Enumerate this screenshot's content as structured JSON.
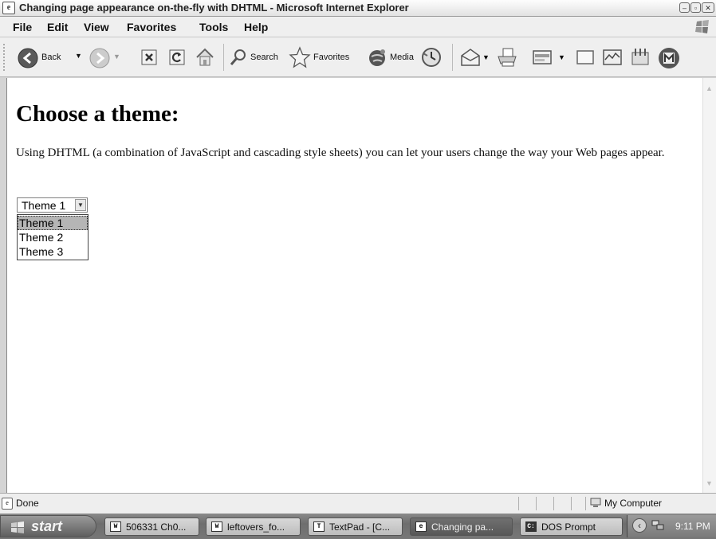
{
  "window": {
    "title": "Changing page appearance on-the-fly with DHTML - Microsoft Internet Explorer",
    "title_icon": "ie-page-icon",
    "controls": [
      "minimize",
      "maximize",
      "close"
    ]
  },
  "menu": {
    "items": [
      "File",
      "Edit",
      "View",
      "Favorites",
      "Tools",
      "Help"
    ]
  },
  "toolbar": {
    "back_label": "Back",
    "search_label": "Search",
    "favorites_label": "Favorites",
    "media_label": "Media"
  },
  "page": {
    "heading": "Choose a theme:",
    "intro": "Using DHTML (a combination of JavaScript and cascading style sheets) you can let your users change the way your Web pages appear.",
    "select": {
      "value": "Theme 1",
      "options": [
        "Theme 1",
        "Theme 2",
        "Theme 3"
      ]
    }
  },
  "status": {
    "text": "Done",
    "zone": "My Computer"
  },
  "taskbar": {
    "start_label": "start",
    "tasks": [
      {
        "label": "506331 Ch0...",
        "icon": "word-icon",
        "active": false
      },
      {
        "label": "leftovers_fo...",
        "icon": "word-icon",
        "active": false
      },
      {
        "label": "TextPad - [C...",
        "icon": "textpad-icon",
        "active": false
      },
      {
        "label": "Changing pa...",
        "icon": "ie-icon",
        "active": true
      },
      {
        "label": "DOS Prompt",
        "icon": "dos-icon",
        "active": false
      }
    ],
    "clock": "9:11 PM"
  }
}
